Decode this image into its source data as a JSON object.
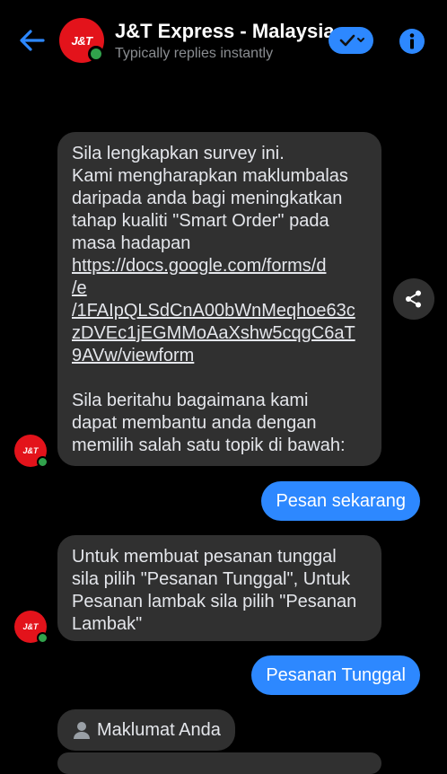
{
  "header": {
    "title": "J&T Express - Malaysia",
    "subtitle": "Typically replies instantly",
    "avatar_logo": "J&T"
  },
  "messages": {
    "survey": {
      "lines": [
        "Sila lengkapkan survey ini.",
        "Kami mengharapkan maklumbalas",
        "daripada anda bagi meningkatkan",
        "tahap kualiti \"Smart Order\" pada",
        "masa hadapan"
      ],
      "link_lines": [
        "https://docs.google.com/forms/d",
        "/e",
        "/1FAIpQLSdCnA00bWnMeqhoe63c",
        "zDVEc1jEGMMoAaXshw5cqgC6aT",
        "9AVw/viewform"
      ],
      "lines2": [
        "Sila beritahu bagaimana kami",
        "dapat membantu anda dengan",
        "memilih salah satu topik di bawah:"
      ]
    },
    "reply1": "Pesan sekarang",
    "instructions": {
      "lines": [
        "Untuk membuat pesanan tunggal",
        "sila pilih \"Pesanan Tunggal\", Untuk",
        "Pesanan lambak sila pilih \"Pesanan",
        "Lambak\""
      ]
    },
    "reply2": "Pesanan Tunggal",
    "profile_label": "Maklumat Anda"
  },
  "colors": {
    "accent": "#2d88ff",
    "bubble_in": "#303030",
    "brand_red": "#e3131b",
    "online": "#31a24c"
  }
}
